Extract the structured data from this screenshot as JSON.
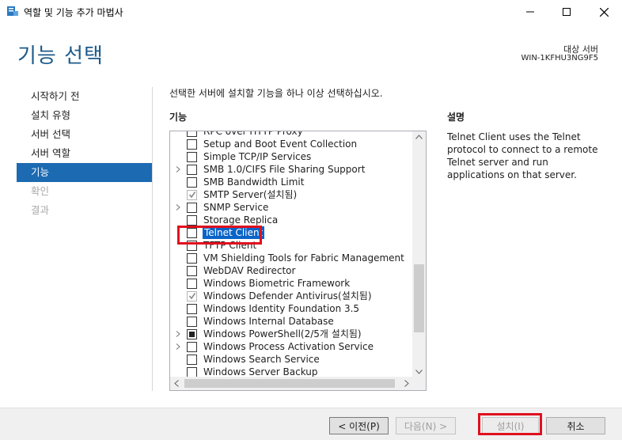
{
  "window": {
    "title": "역할 및 기능 추가 마법사",
    "controls": [
      "minimize",
      "maximize",
      "close"
    ]
  },
  "header": {
    "page_title": "기능 선택",
    "target_label": "대상 서버",
    "target_server": "WIN-1KFHU3NG9F5"
  },
  "nav": {
    "items": [
      {
        "label": "시작하기 전",
        "state": "normal"
      },
      {
        "label": "설치 유형",
        "state": "normal"
      },
      {
        "label": "서버 선택",
        "state": "normal"
      },
      {
        "label": "서버 역할",
        "state": "normal"
      },
      {
        "label": "기능",
        "state": "active"
      },
      {
        "label": "확인",
        "state": "disabled"
      },
      {
        "label": "결과",
        "state": "disabled"
      }
    ]
  },
  "content": {
    "instruction": "선택한 서버에 설치할 기능을 하나 이상 선택하십시오.",
    "features_heading": "기능",
    "description_heading": "설명",
    "description": "Telnet Client uses the Telnet protocol to connect to a remote Telnet server and run applications on that server.",
    "features": [
      {
        "label": "RPC over HTTP Proxy",
        "checked": "none",
        "expandable": false,
        "greyed": false
      },
      {
        "label": "Setup and Boot Event Collection",
        "checked": "none",
        "expandable": false,
        "greyed": false
      },
      {
        "label": "Simple TCP/IP Services",
        "checked": "none",
        "expandable": false,
        "greyed": false
      },
      {
        "label": "SMB 1.0/CIFS File Sharing Support",
        "checked": "none",
        "expandable": true,
        "greyed": false
      },
      {
        "label": "SMB Bandwidth Limit",
        "checked": "none",
        "expandable": false,
        "greyed": false
      },
      {
        "label": "SMTP Server(설치됨)",
        "checked": "checked",
        "expandable": false,
        "greyed": true
      },
      {
        "label": "SNMP Service",
        "checked": "none",
        "expandable": true,
        "greyed": false
      },
      {
        "label": "Storage Replica",
        "checked": "none",
        "expandable": false,
        "greyed": false
      },
      {
        "label": "Telnet Client",
        "checked": "none",
        "expandable": false,
        "greyed": false,
        "selected": true
      },
      {
        "label": "TFTP Client",
        "checked": "none",
        "expandable": false,
        "greyed": false
      },
      {
        "label": "VM Shielding Tools for Fabric Management",
        "checked": "none",
        "expandable": false,
        "greyed": false
      },
      {
        "label": "WebDAV Redirector",
        "checked": "none",
        "expandable": false,
        "greyed": false
      },
      {
        "label": "Windows Biometric Framework",
        "checked": "none",
        "expandable": false,
        "greyed": false
      },
      {
        "label": "Windows Defender Antivirus(설치됨)",
        "checked": "checked",
        "expandable": false,
        "greyed": true
      },
      {
        "label": "Windows Identity Foundation 3.5",
        "checked": "none",
        "expandable": false,
        "greyed": false
      },
      {
        "label": "Windows Internal Database",
        "checked": "none",
        "expandable": false,
        "greyed": false
      },
      {
        "label": "Windows PowerShell(2/5개 설치됨)",
        "checked": "partial",
        "expandable": true,
        "greyed": false
      },
      {
        "label": "Windows Process Activation Service",
        "checked": "none",
        "expandable": true,
        "greyed": false
      },
      {
        "label": "Windows Search Service",
        "checked": "none",
        "expandable": false,
        "greyed": false
      },
      {
        "label": "Windows Server Backup",
        "checked": "none",
        "expandable": false,
        "greyed": false
      }
    ]
  },
  "footer": {
    "prev_label": "< 이전(P)",
    "next_label": "다음(N) >",
    "install_label": "설치(I)",
    "cancel_label": "취소"
  },
  "colors": {
    "accent": "#1b6ab2",
    "title_blue": "#1c5a8a",
    "highlight_red": "#e0101e",
    "selection": "#0a64c8"
  }
}
